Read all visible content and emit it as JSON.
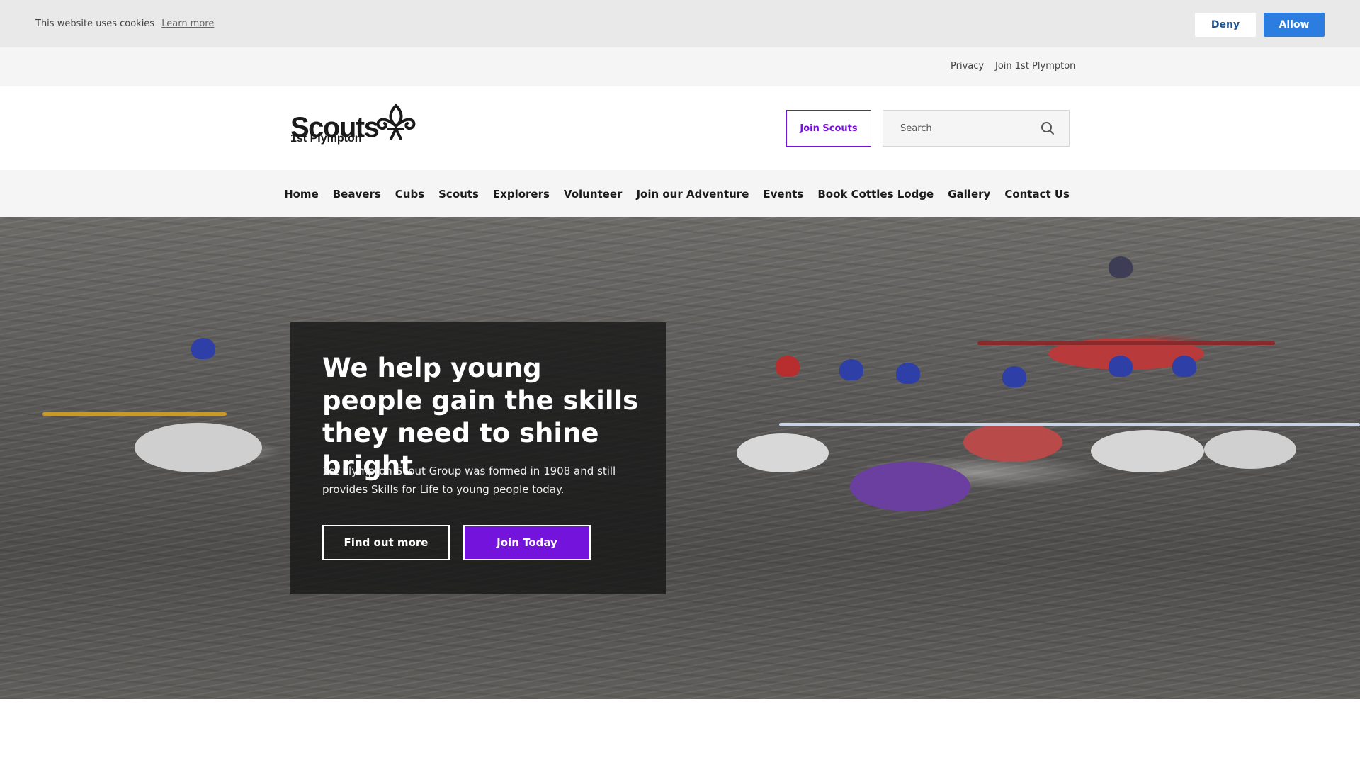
{
  "cookie_bar": {
    "message": "This website uses cookies",
    "learn_more": "Learn more",
    "deny_label": "Deny",
    "allow_label": "Allow"
  },
  "utility_links": [
    "Privacy",
    "Join 1st Plympton"
  ],
  "header": {
    "logo_word": "Scouts",
    "logo_sub": "1st Plympton",
    "join_button": "Join Scouts",
    "search_placeholder": "Search"
  },
  "nav": {
    "items": [
      "Home",
      "Beavers",
      "Cubs",
      "Scouts",
      "Explorers",
      "Volunteer",
      "Join our Adventure",
      "Events",
      "Book Cottles Lodge",
      "Gallery",
      "Contact Us"
    ]
  },
  "hero": {
    "title": "We help young people gain the skills they need to shine bright",
    "text": "1st Plympton Scout Group was formed in 1908 and still provides Skills for Life to young people today.",
    "primary_button": "Find out more",
    "secondary_button": "Join Today"
  },
  "colors": {
    "brand_purple": "#7413dc",
    "allow_blue": "#2b7de0"
  }
}
